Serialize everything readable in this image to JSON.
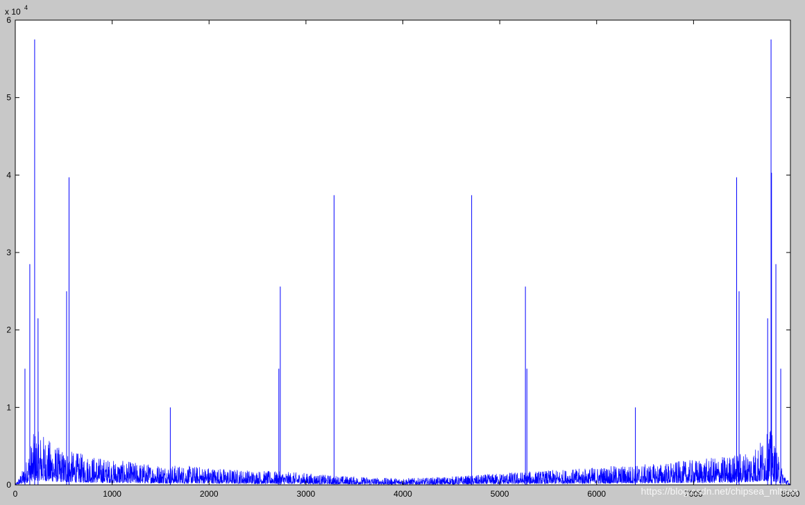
{
  "chart_data": {
    "type": "line",
    "title": "",
    "xlabel": "",
    "ylabel": "",
    "x_range": [
      0,
      8000
    ],
    "y_range": [
      0,
      60000
    ],
    "xlim": [
      0,
      8000
    ],
    "ylim": [
      0,
      60000
    ],
    "y_exponent_label": "x 10",
    "y_exponent_power": "4",
    "x_ticks": [
      0,
      1000,
      2000,
      3000,
      4000,
      5000,
      6000,
      7000,
      8000
    ],
    "x_tick_labels": [
      "0",
      "1000",
      "2000",
      "3000",
      "4000",
      "5000",
      "6000",
      "7000",
      "8000"
    ],
    "y_ticks": [
      0,
      10000,
      20000,
      30000,
      40000,
      50000,
      60000
    ],
    "y_tick_labels": [
      "0",
      "1",
      "2",
      "3",
      "4",
      "5",
      "6"
    ],
    "grid": false,
    "legend": "none",
    "series": [
      {
        "color": "#0000ff",
        "x": [
          0,
          100,
          200,
          300,
          400,
          500,
          600,
          700,
          800,
          900,
          1000,
          1200,
          1400,
          1600,
          1800,
          2000,
          2200,
          2400,
          2600,
          2800,
          3000,
          3200,
          3400,
          3600,
          3800,
          4000,
          4200,
          4400,
          4600,
          4800,
          5000,
          5200,
          5400,
          5600,
          5800,
          6000,
          6200,
          6400,
          6600,
          6800,
          7000,
          7200,
          7400,
          7600,
          7700,
          7800,
          7900,
          8000
        ],
        "noise_envelope": [
          0,
          2000,
          5500,
          5000,
          4000,
          3500,
          3300,
          3100,
          2900,
          2700,
          2500,
          2300,
          2100,
          2000,
          1900,
          1800,
          1600,
          1500,
          1400,
          1300,
          1200,
          1000,
          900,
          800,
          700,
          700,
          700,
          800,
          900,
          1000,
          1200,
          1300,
          1400,
          1500,
          1600,
          1800,
          1900,
          2000,
          2100,
          2300,
          2500,
          2700,
          3000,
          3500,
          4500,
          5500,
          2000,
          0
        ],
        "peaks": [
          {
            "x": 100,
            "y": 15000
          },
          {
            "x": 150,
            "y": 28500
          },
          {
            "x": 200,
            "y": 57500
          },
          {
            "x": 235,
            "y": 21500
          },
          {
            "x": 530,
            "y": 25000
          },
          {
            "x": 555,
            "y": 39700
          },
          {
            "x": 1600,
            "y": 10000
          },
          {
            "x": 2720,
            "y": 15000
          },
          {
            "x": 2735,
            "y": 25600
          },
          {
            "x": 3290,
            "y": 37400
          },
          {
            "x": 4710,
            "y": 37400
          },
          {
            "x": 5265,
            "y": 25600
          },
          {
            "x": 5280,
            "y": 15000
          },
          {
            "x": 6400,
            "y": 10000
          },
          {
            "x": 7445,
            "y": 39700
          },
          {
            "x": 7470,
            "y": 25000
          },
          {
            "x": 7765,
            "y": 21500
          },
          {
            "x": 7800,
            "y": 57500
          },
          {
            "x": 7805,
            "y": 40300
          },
          {
            "x": 7850,
            "y": 28500
          },
          {
            "x": 7900,
            "y": 15000
          }
        ]
      }
    ]
  },
  "watermark": "https://blog.csdn.net/chipsea_mltsea"
}
